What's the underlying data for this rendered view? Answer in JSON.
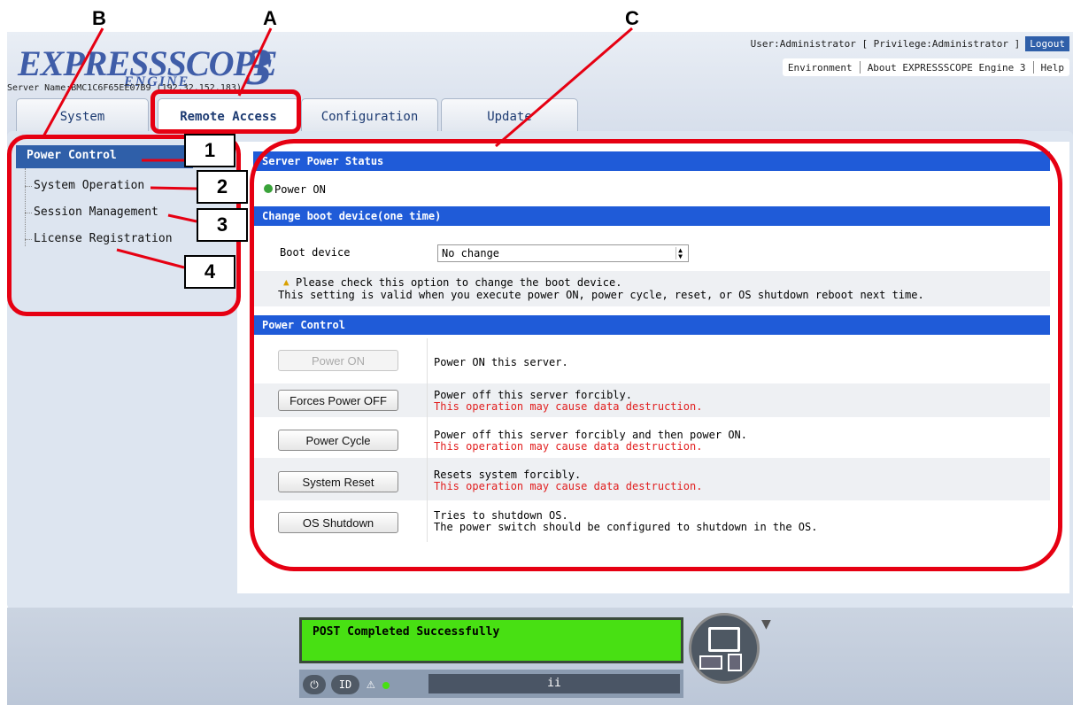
{
  "callouts": {
    "a": "A",
    "b": "B",
    "c": "C"
  },
  "header": {
    "logo_main": "EXPRESSSCOPE",
    "logo_sub": "ENGINE",
    "logo_num": "3",
    "server_name": "Server Name:BMC1C6F65EE07B9 (192.32.152.183)",
    "user_info": "User:Administrator [ Privilege:Administrator ]",
    "logout": "Logout",
    "links": [
      "Environment",
      "About EXPRESSSCOPE Engine 3",
      "Help"
    ]
  },
  "tabs": [
    {
      "label": "System",
      "active": false
    },
    {
      "label": "Remote Access",
      "active": true
    },
    {
      "label": "Configuration",
      "active": false
    },
    {
      "label": "Update",
      "active": false
    }
  ],
  "sidebar": {
    "items": [
      {
        "label": "Power Control",
        "active": true
      },
      {
        "label": "System Operation",
        "active": false
      },
      {
        "label": "Session Management",
        "active": false
      },
      {
        "label": "License Registration",
        "active": false
      }
    ]
  },
  "number_labels": [
    "1",
    "2",
    "3",
    "4"
  ],
  "server_power_status": {
    "header": "Server Power Status",
    "status_text": "Power ON",
    "status_color": "#3aa33a"
  },
  "boot_device": {
    "header": "Change boot device(one time)",
    "label": "Boot device",
    "selected": "No change",
    "note_line1": "Please check this option to change the boot device.",
    "note_line2": "This setting is valid when you execute power ON, power cycle, reset, or OS shutdown reboot next time."
  },
  "power_control": {
    "header": "Power Control",
    "actions": [
      {
        "button": "Power ON",
        "enabled": false,
        "desc": "Power ON this server.",
        "warning": ""
      },
      {
        "button": "Forces Power OFF",
        "enabled": true,
        "desc": "Power off this server forcibly.",
        "warning": "This operation may cause data destruction."
      },
      {
        "button": "Power Cycle",
        "enabled": true,
        "desc": "Power off this server forcibly and then power ON.",
        "warning": "This operation may cause data destruction."
      },
      {
        "button": "System Reset",
        "enabled": true,
        "desc": "Resets system forcibly.",
        "warning": "This operation may cause data destruction."
      },
      {
        "button": "OS Shutdown",
        "enabled": true,
        "desc": "Tries to shutdown OS.",
        "warning": "The power switch should be configured to shutdown in the OS."
      }
    ]
  },
  "footer": {
    "lcd_text": "POST Completed Successfully",
    "id_button": "ID",
    "lcd_strip": "ii"
  },
  "colors": {
    "accent": "#1f5bd8",
    "annotation": "#e60012",
    "warning": "#e11d1d",
    "lcd": "#48e013"
  }
}
